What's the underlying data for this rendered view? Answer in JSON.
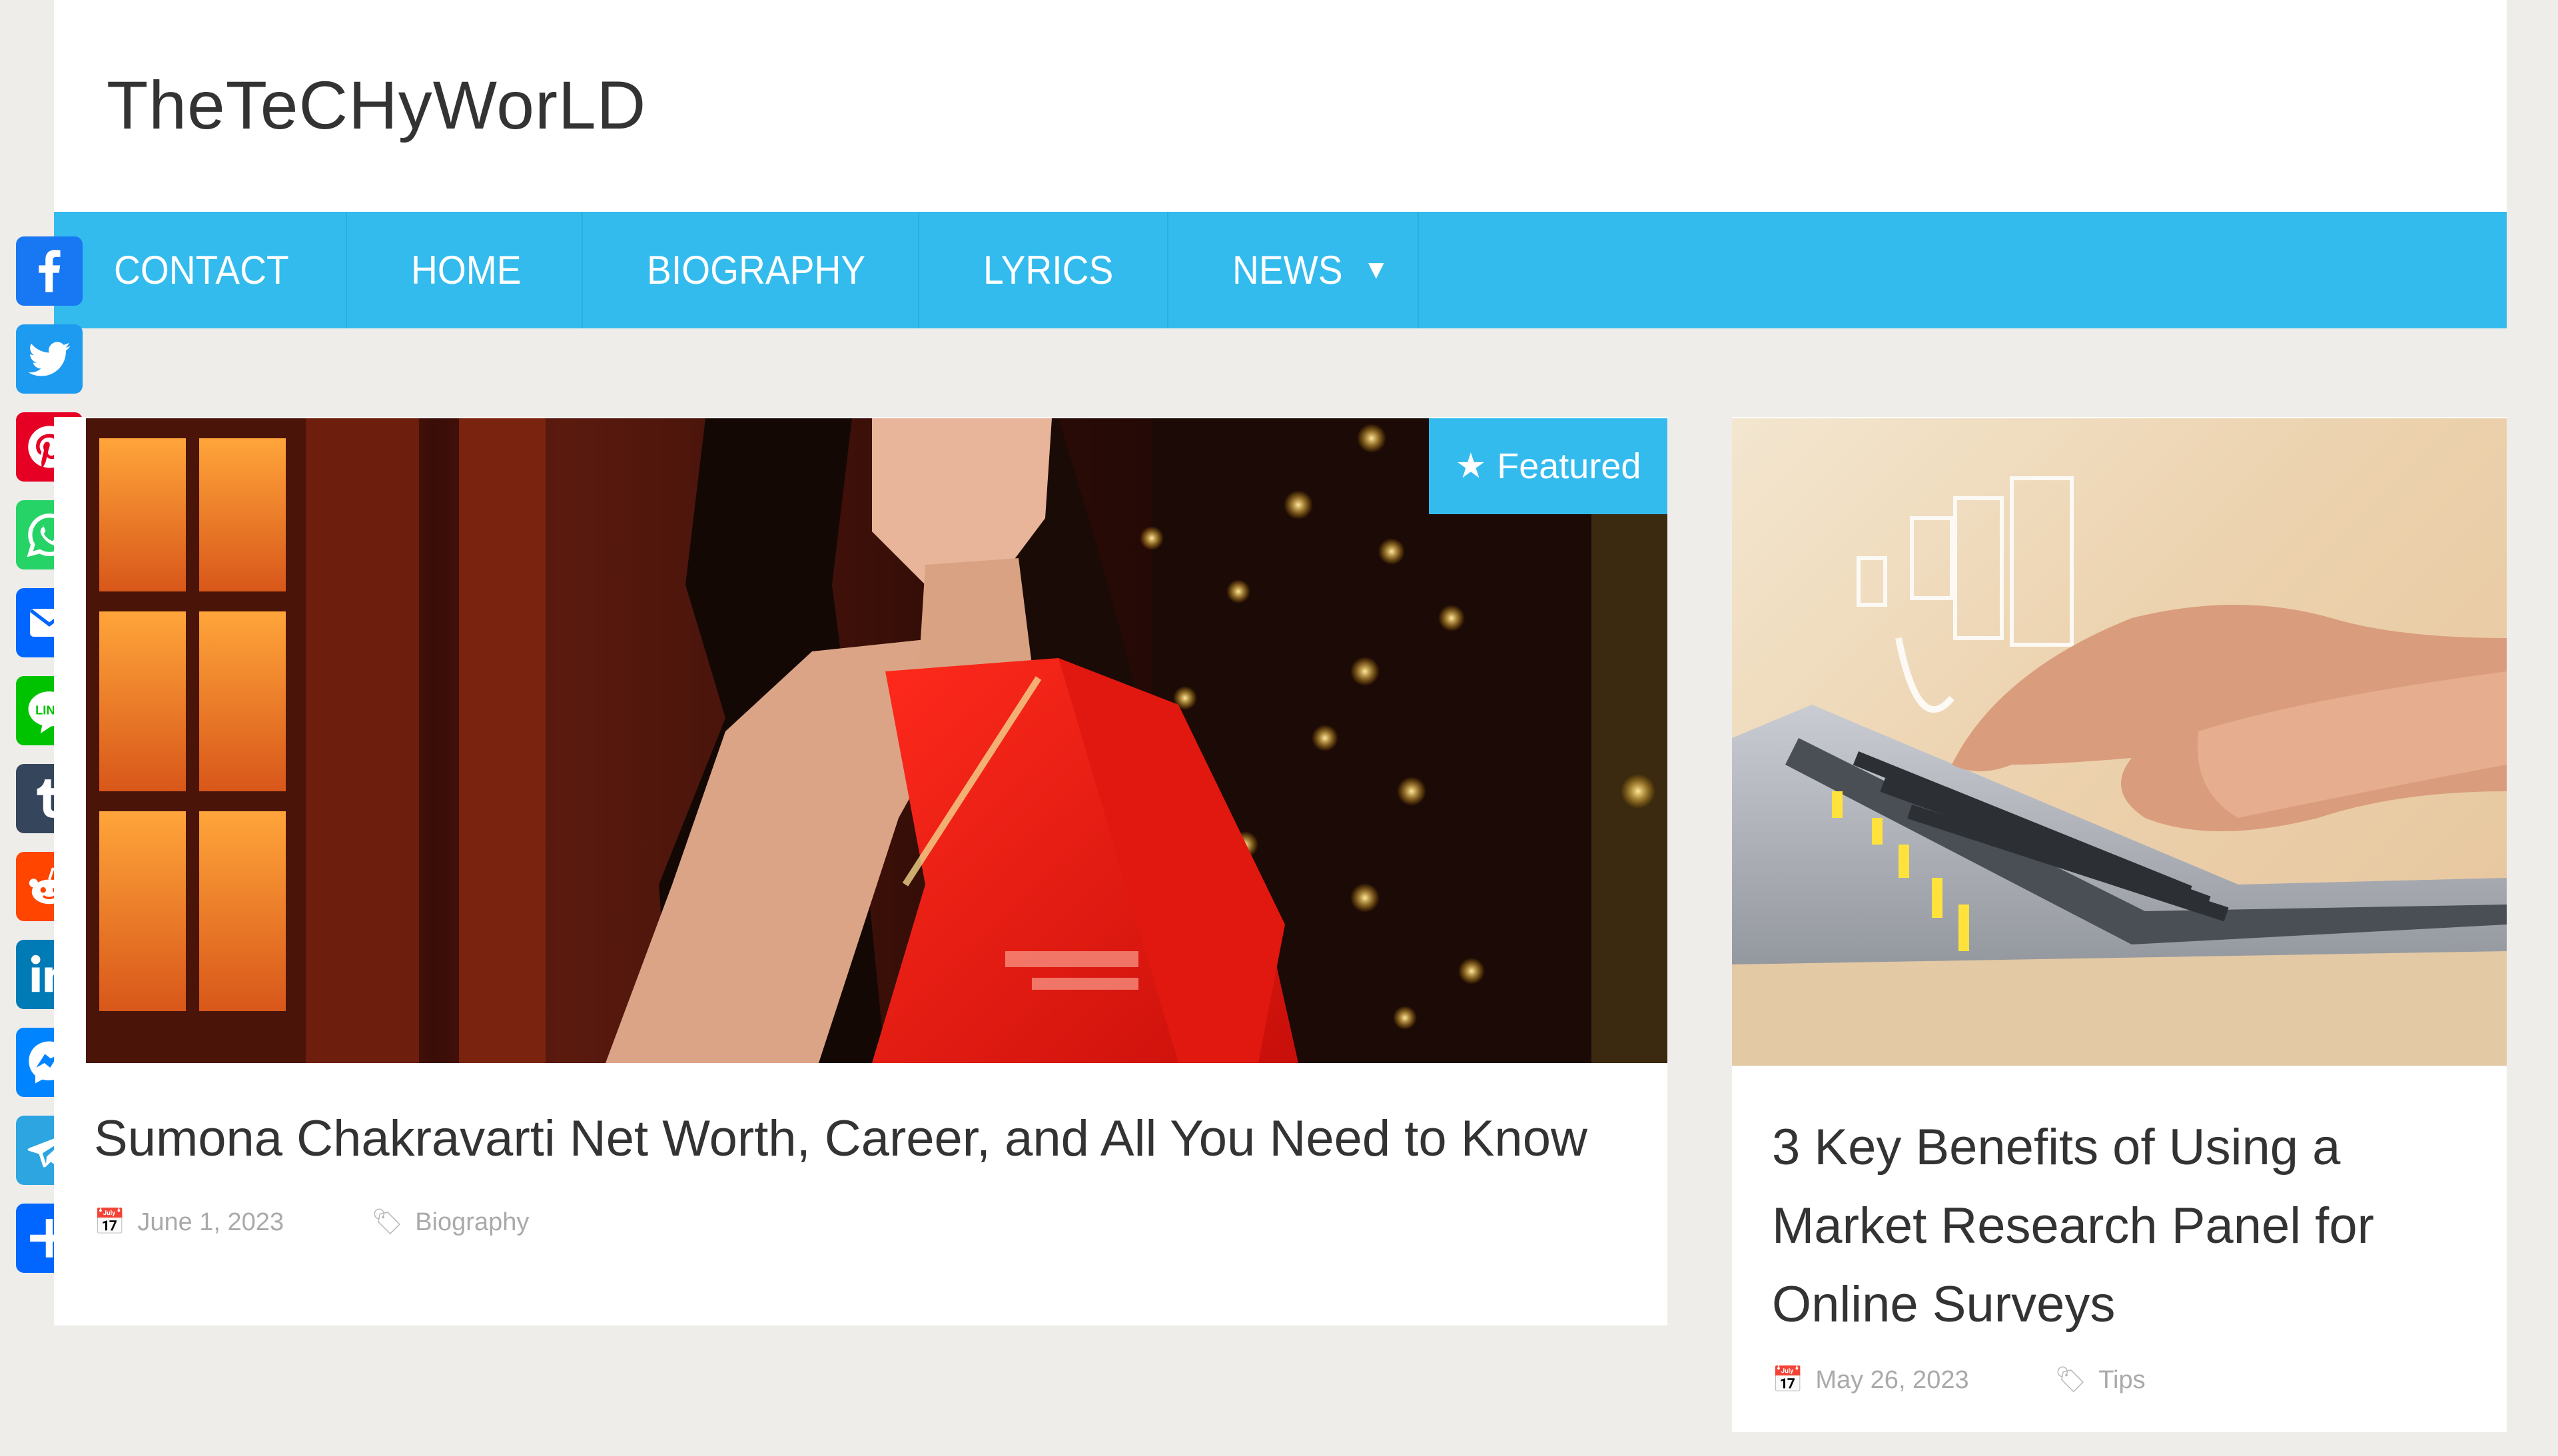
{
  "site": {
    "title": "TheTeCHyWorLD"
  },
  "nav": {
    "items": [
      {
        "label": "CONTACT"
      },
      {
        "label": "HOME"
      },
      {
        "label": "BIOGRAPHY"
      },
      {
        "label": "LYRICS"
      },
      {
        "label": "NEWS",
        "has_dropdown": true
      }
    ],
    "color": "#33bbee"
  },
  "share": {
    "buttons": [
      {
        "icon": "facebook-icon",
        "color": "#1877f2"
      },
      {
        "icon": "twitter-icon",
        "color": "#1d9bf0"
      },
      {
        "icon": "pinterest-icon",
        "color": "#e60023"
      },
      {
        "icon": "whatsapp-icon",
        "color": "#25d366"
      },
      {
        "icon": "email-icon",
        "color": "#0166ff"
      },
      {
        "icon": "line-icon",
        "color": "#00c300"
      },
      {
        "icon": "tumblr-icon",
        "color": "#35465c"
      },
      {
        "icon": "reddit-icon",
        "color": "#ff4500"
      },
      {
        "icon": "linkedin-icon",
        "color": "#007bb5"
      },
      {
        "icon": "messenger-icon",
        "color": "#0084ff"
      },
      {
        "icon": "telegram-icon",
        "color": "#2ca5e0"
      },
      {
        "icon": "share-plus-icon",
        "color": "#0166ff"
      }
    ]
  },
  "posts": {
    "main": {
      "badge": "Featured",
      "title": "Sumona Chakravarti Net Worth, Career, and All You Need to Know",
      "date": "June 1, 2023",
      "category": "Biography"
    },
    "side": {
      "title": "3 Key Benefits of Using a Market Research Panel for Online Surveys",
      "date": "May 26, 2023",
      "category": "Tips"
    }
  }
}
